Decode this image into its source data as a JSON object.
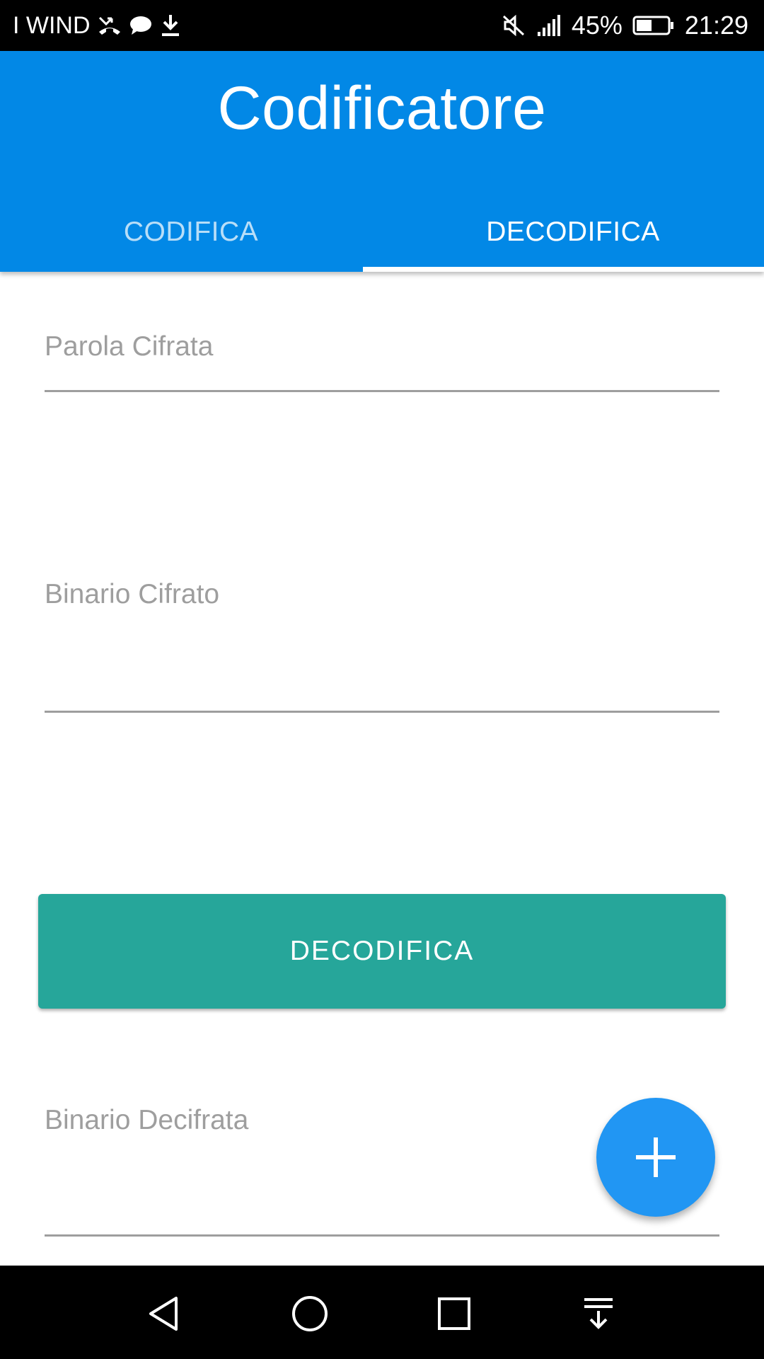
{
  "status_bar": {
    "carrier": "I WIND",
    "battery_percent": "45%",
    "time": "21:29",
    "icons_left": [
      "missed-call-icon",
      "chat-icon",
      "download-icon"
    ],
    "icons_right": [
      "mute-icon",
      "signal-icon",
      "battery-icon"
    ]
  },
  "app_bar": {
    "title": "Codificatore",
    "background": "#0288e6",
    "tabs": [
      {
        "label": "CODIFICA",
        "selected": false
      },
      {
        "label": "DECODIFICA",
        "selected": true
      }
    ]
  },
  "form": {
    "parola_cifrata": {
      "label": "Parola Cifrata",
      "value": ""
    },
    "binario_cifrato": {
      "label": "Binario Cifrato",
      "value": ""
    },
    "decode_button": {
      "label": "DECODIFICA",
      "color": "#26a69a"
    },
    "binario_decifrata": {
      "label": "Binario Decifrata",
      "value": ""
    }
  },
  "fab": {
    "icon": "plus-icon",
    "color": "#2196f3"
  },
  "nav_bar": {
    "icons": [
      "back-icon",
      "home-icon",
      "recents-icon",
      "notification-drawer-icon"
    ]
  }
}
